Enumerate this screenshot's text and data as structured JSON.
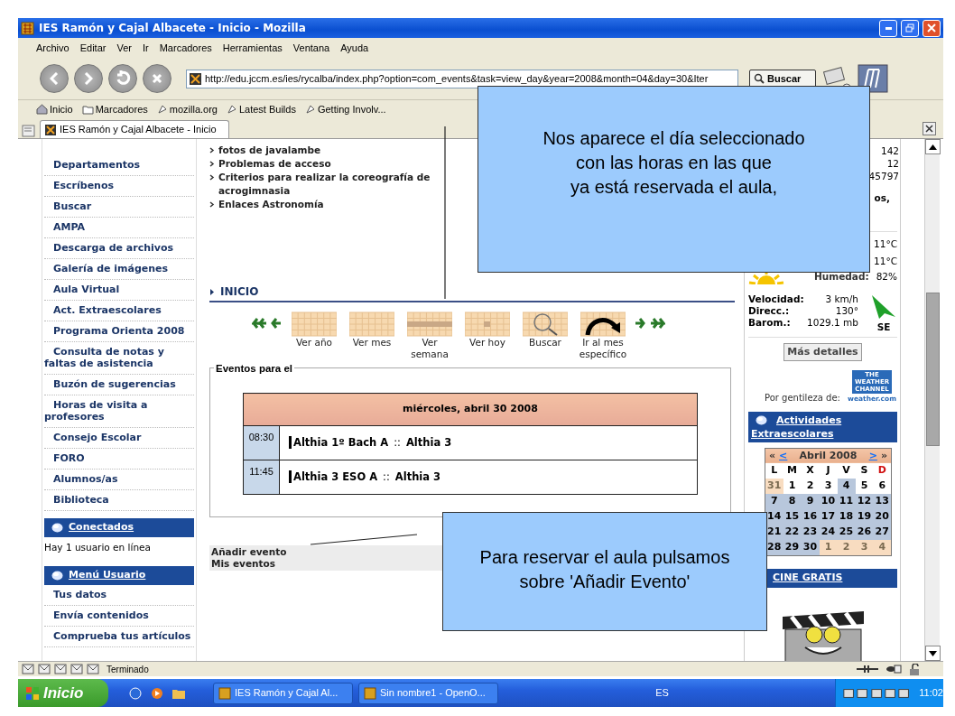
{
  "window": {
    "title": "IES Ramón y Cajal Albacete - Inicio - Mozilla"
  },
  "menu": [
    "Archivo",
    "Editar",
    "Ver",
    "Ir",
    "Marcadores",
    "Herramientas",
    "Ventana",
    "Ayuda"
  ],
  "navigation": {
    "url": "http://edu.jccm.es/ies/rycalba/index.php?option=com_events&task=view_day&year=2008&month=04&day=30&Iter",
    "search_button": "Buscar"
  },
  "bookmarks": [
    {
      "label": "Inicio",
      "kind": "home"
    },
    {
      "label": "Marcadores",
      "kind": "folder"
    },
    {
      "label": "mozilla.org",
      "kind": "link"
    },
    {
      "label": "Latest Builds",
      "kind": "link"
    },
    {
      "label": "Getting Involv...",
      "kind": "link"
    }
  ],
  "tab": {
    "title": "IES Ramón y Cajal Albacete - Inicio"
  },
  "sidebar": {
    "items": [
      "Departamentos",
      "Escríbenos",
      "Buscar",
      "AMPA",
      "Descarga de archivos",
      "Galería de imágenes",
      "Aula Virtual",
      "Act. Extraescolares",
      "Programa Orienta 2008",
      "Consulta de notas y faltas de asistencia",
      "Buzón de sugerencias",
      "Horas de visita a profesores",
      "Consejo Escolar",
      "FORO",
      "Alumnos/as",
      "Biblioteca"
    ],
    "online": {
      "header": "Conectados",
      "text": "Hay 1 usuario en línea"
    },
    "user_menu": {
      "header": "Menú Usuario",
      "items": [
        "Tus datos",
        "Envía contenidos",
        "Comprueba tus artículos"
      ]
    }
  },
  "main": {
    "links": [
      "fotos de javalambe",
      "Problemas de acceso",
      "Criterios para realizar la coreografía de acrogimnasia",
      "Enlaces Astronomía"
    ],
    "section_title": "INICIO",
    "toolbar": [
      {
        "label": "Ver año",
        "kind": "year"
      },
      {
        "label": "Ver mes",
        "kind": "month"
      },
      {
        "label": "Ver semana",
        "kind": "week"
      },
      {
        "label": "Ver hoy",
        "kind": "today"
      },
      {
        "label": "Buscar",
        "kind": "search"
      },
      {
        "label": "Ir al mes específico",
        "kind": "goto"
      }
    ],
    "events_box": {
      "legend": "Eventos para el",
      "date": "miércoles, abril 30 2008",
      "events": [
        {
          "time": "08:30",
          "title": "Althia 1º Bach A",
          "separator": "::",
          "place": "Althia 3"
        },
        {
          "time": "11:45",
          "title": "Althia 3 ESO A",
          "separator": "::",
          "place": "Althia 3"
        }
      ]
    },
    "footer_links": [
      "Añadir evento",
      "Mis eventos"
    ]
  },
  "right": {
    "stats": [
      "142",
      "12",
      "45797"
    ],
    "stats_fragment": "os,",
    "weather": {
      "temps": [
        "11°C",
        "11°C"
      ],
      "humidity_label": "Humedad:",
      "humidity": "82%",
      "wind": [
        {
          "label": "Velocidad:",
          "value": "3 km/h"
        },
        {
          "label": "Direcc.:",
          "value": "130°"
        },
        {
          "label": "Barom.:",
          "value": "1029.1 mb"
        }
      ],
      "direction": "SE",
      "details_button": "Más detalles",
      "credit": "Por gentileza de:",
      "logo_lines": [
        "THE",
        "WEATHER",
        "CHANNEL"
      ],
      "logo_site": "weather.com"
    },
    "activities": {
      "header": "Actividades Extraescolares",
      "calendar": {
        "prev_year": "«",
        "prev": "<",
        "month": "Abril 2008",
        "next": ">",
        "next_year": "»",
        "weekdays": [
          {
            "label": "L",
            "kind": "weekday"
          },
          {
            "label": "M",
            "kind": "weekday"
          },
          {
            "label": "X",
            "kind": "weekday"
          },
          {
            "label": "J",
            "kind": "weekday"
          },
          {
            "label": "V",
            "kind": "weekday"
          },
          {
            "label": "S",
            "kind": "weekday"
          },
          {
            "label": "D",
            "kind": "sunday"
          }
        ],
        "weeks": [
          [
            {
              "day": "31",
              "kind": "other"
            },
            {
              "day": "1",
              "kind": "plain"
            },
            {
              "day": "2",
              "kind": "plain"
            },
            {
              "day": "3",
              "kind": "plain"
            },
            {
              "day": "4",
              "kind": "event"
            },
            {
              "day": "5",
              "kind": "plain"
            },
            {
              "day": "6",
              "kind": "plain"
            }
          ],
          [
            {
              "day": "7",
              "kind": "event"
            },
            {
              "day": "8",
              "kind": "event"
            },
            {
              "day": "9",
              "kind": "event"
            },
            {
              "day": "10",
              "kind": "event"
            },
            {
              "day": "11",
              "kind": "event"
            },
            {
              "day": "12",
              "kind": "event"
            },
            {
              "day": "13",
              "kind": "event"
            }
          ],
          [
            {
              "day": "14",
              "kind": "event"
            },
            {
              "day": "15",
              "kind": "event"
            },
            {
              "day": "16",
              "kind": "event"
            },
            {
              "day": "17",
              "kind": "event"
            },
            {
              "day": "18",
              "kind": "event"
            },
            {
              "day": "19",
              "kind": "event"
            },
            {
              "day": "20",
              "kind": "event"
            }
          ],
          [
            {
              "day": "21",
              "kind": "event"
            },
            {
              "day": "22",
              "kind": "event"
            },
            {
              "day": "23",
              "kind": "event"
            },
            {
              "day": "24",
              "kind": "event"
            },
            {
              "day": "25",
              "kind": "event"
            },
            {
              "day": "26",
              "kind": "event"
            },
            {
              "day": "27",
              "kind": "event"
            }
          ],
          [
            {
              "day": "28",
              "kind": "event"
            },
            {
              "day": "29",
              "kind": "event"
            },
            {
              "day": "30",
              "kind": "event"
            },
            {
              "day": "1",
              "kind": "other"
            },
            {
              "day": "2",
              "kind": "other"
            },
            {
              "day": "3",
              "kind": "other"
            },
            {
              "day": "4",
              "kind": "other"
            }
          ]
        ]
      }
    },
    "cinema": {
      "header": "CINE GRATIS"
    }
  },
  "callouts": [
    {
      "lines": [
        "Nos aparece el día seleccionado",
        "con las horas en las que",
        "ya está reservada el aula,"
      ]
    },
    {
      "lines": [
        "Para reservar el aula pulsamos",
        "sobre 'Añadir Evento'"
      ]
    }
  ],
  "status_bar": {
    "text": "Terminado"
  },
  "taskbar": {
    "start": "Inicio",
    "tasks": [
      "IES Ramón y Cajal Al...",
      "Sin nombre1 - OpenO..."
    ],
    "language": "ES",
    "clock": "11:02"
  }
}
